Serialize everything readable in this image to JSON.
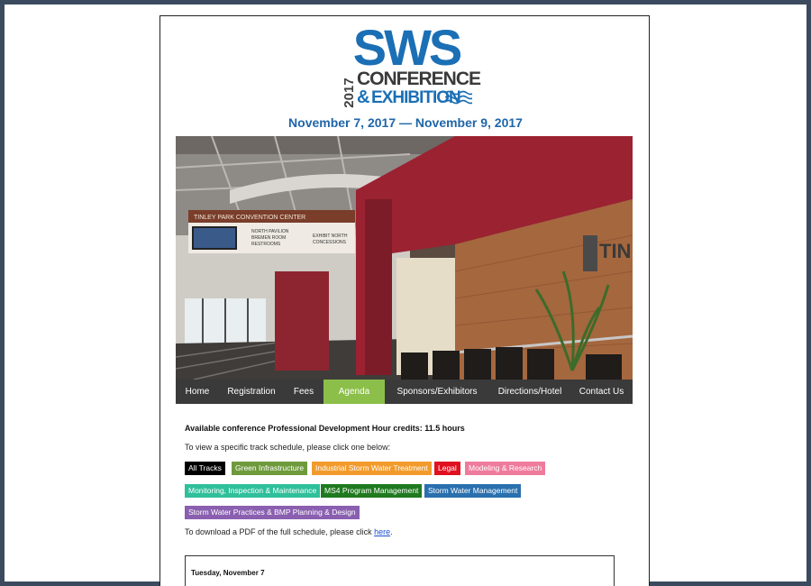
{
  "logo": {
    "brand": "SWS",
    "year": "2017",
    "line1": "CONFERENCE",
    "ampersand": "&",
    "line2": "EXHIBITION"
  },
  "dates": "November 7, 2017 — November 9, 2017",
  "hero": {
    "signs": {
      "venue": "TINLEY PARK CONVENTION CENTER",
      "left_1": "NORTH PAVILION",
      "left_2": "BREMEN ROOM",
      "left_3": "RESTROOMS",
      "right_1": "EXHIBIT NORTH",
      "right_2": "CONCESSIONS",
      "wall": "TIN"
    }
  },
  "nav": {
    "items": [
      {
        "label": "Home"
      },
      {
        "label": "Registration"
      },
      {
        "label": "Fees"
      },
      {
        "label": "Agenda"
      },
      {
        "label": "Sponsors/Exhibitors"
      },
      {
        "label": "Directions/Hotel"
      },
      {
        "label": "Contact Us"
      }
    ],
    "active": "Agenda"
  },
  "content": {
    "credits": "Available conference Professional Development Hour credits: 11.5 hours",
    "instruction": "To view a specific track schedule, please click one below:",
    "tracks": [
      {
        "label": "All Tracks",
        "color": "#000000"
      },
      {
        "label": "Green Infrastructure",
        "color": "#6f9a3c"
      },
      {
        "label": "Industrial Storm Water Treatment",
        "color": "#f29b2c"
      },
      {
        "label": "Legal",
        "color": "#e0101f"
      },
      {
        "label": "Modeling & Research",
        "color": "#ef7b9c"
      },
      {
        "label": "Monitoring, Inspection & Maintenance",
        "color": "#2fbf9b"
      },
      {
        "label": "MS4 Program Management",
        "color": "#1f7a1f"
      },
      {
        "label": "Storm Water Management",
        "color": "#2a6fae"
      },
      {
        "label": "Storm Water Practices & BMP Planning & Design",
        "color": "#8a5fb0"
      }
    ],
    "download_prefix": "To download a PDF of the full schedule, please click ",
    "download_link": "here",
    "download_suffix": "."
  },
  "schedule": {
    "day": "Tuesday, November 7"
  }
}
